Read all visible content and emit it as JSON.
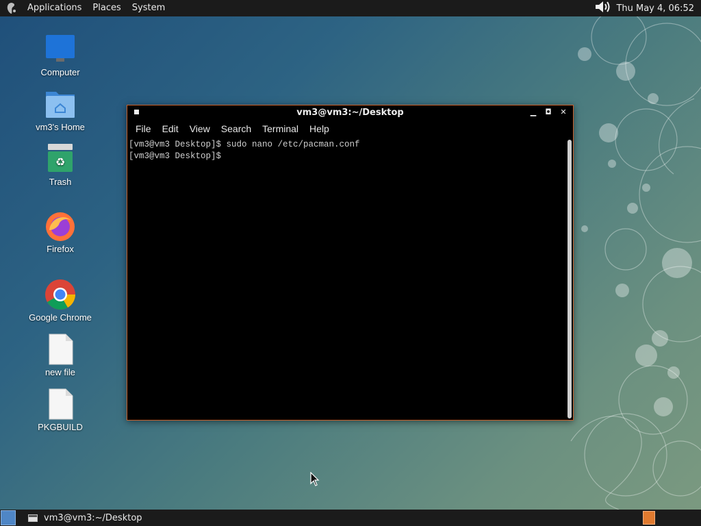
{
  "top_panel": {
    "menus": [
      "Applications",
      "Places",
      "System"
    ],
    "clock": "Thu May  4, 06:52",
    "volume_icon": "volume-icon"
  },
  "desktop_icons": [
    {
      "label": "Computer",
      "icon": "computer-icon"
    },
    {
      "label": "vm3's Home",
      "icon": "home-folder-icon"
    },
    {
      "label": "Trash",
      "icon": "trash-icon"
    },
    {
      "label": "Firefox",
      "icon": "firefox-icon"
    },
    {
      "label": "Google Chrome",
      "icon": "chrome-icon"
    },
    {
      "label": "new file",
      "icon": "file-icon"
    },
    {
      "label": "PKGBUILD",
      "icon": "file-icon"
    }
  ],
  "terminal": {
    "title": "vm3@vm3:~/Desktop",
    "menus": [
      "File",
      "Edit",
      "View",
      "Search",
      "Terminal",
      "Help"
    ],
    "lines": [
      "[vm3@vm3 Desktop]$ sudo nano /etc/pacman.conf",
      "[vm3@vm3 Desktop]$ "
    ]
  },
  "bottom_panel": {
    "task_label": "vm3@vm3:~/Desktop"
  },
  "colors": {
    "panel": "#1b1b1b",
    "window_border": "#c9622e",
    "workspace": "#e07a2f"
  }
}
